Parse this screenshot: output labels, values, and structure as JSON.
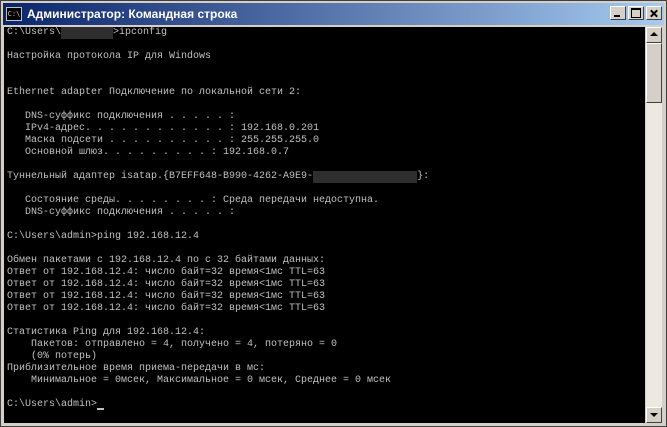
{
  "window": {
    "title": "Администратор: Командная строка",
    "icon": "cmd-icon",
    "icon_text": "C:\\"
  },
  "console": {
    "lines": [
      "C:\\Users\\",
      "",
      "Настройка протокола IP для Windows",
      "",
      "",
      "Ethernet adapter Подключение по локальной сети 2:",
      "",
      "   DNS-суффикс подключения . . . . . :",
      "   IPv4-адрес. . . . . . . . . . . . : 192.168.0.201",
      "   Маска подсети . . . . . . . . . . : 255.255.255.0",
      "   Основной шлюз. . . . . . . . . : 192.168.0.7",
      "",
      "Туннельный адаптер isatap.{B7EFF648-B990-4262-A9E9-",
      "",
      "   Состояние среды. . . . . . . . : Среда передачи недоступна.",
      "   DNS-суффикс подключения . . . . . :",
      "",
      "C:\\Users\\admin>ping 192.168.12.4",
      "",
      "Обмен пакетами с 192.168.12.4 по с 32 байтами данных:",
      "Ответ от 192.168.12.4: число байт=32 время<1мс TTL=63",
      "Ответ от 192.168.12.4: число байт=32 время<1мс TTL=63",
      "Ответ от 192.168.12.4: число байт=32 время<1мс TTL=63",
      "Ответ от 192.168.12.4: число байт=32 время<1мс TTL=63",
      "",
      "Статистика Ping для 192.168.12.4:",
      "    Пакетов: отправлено = 4, получено = 4, потеряно = 0",
      "    (0% потерь)",
      "Приблизительное время приема-передачи в мс:",
      "    Минимальное = 0мсек, Максимальное = 0 мсек, Среднее = 0 мсек",
      "",
      "C:\\Users\\admin>"
    ],
    "line1_suffix": ">ipconfig",
    "line13_suffix": "}:"
  },
  "colors": {
    "console_bg": "#000000",
    "console_text": "#c0c0c0",
    "title_gradient_start": "#0a246a",
    "title_gradient_end": "#a6caf0"
  }
}
